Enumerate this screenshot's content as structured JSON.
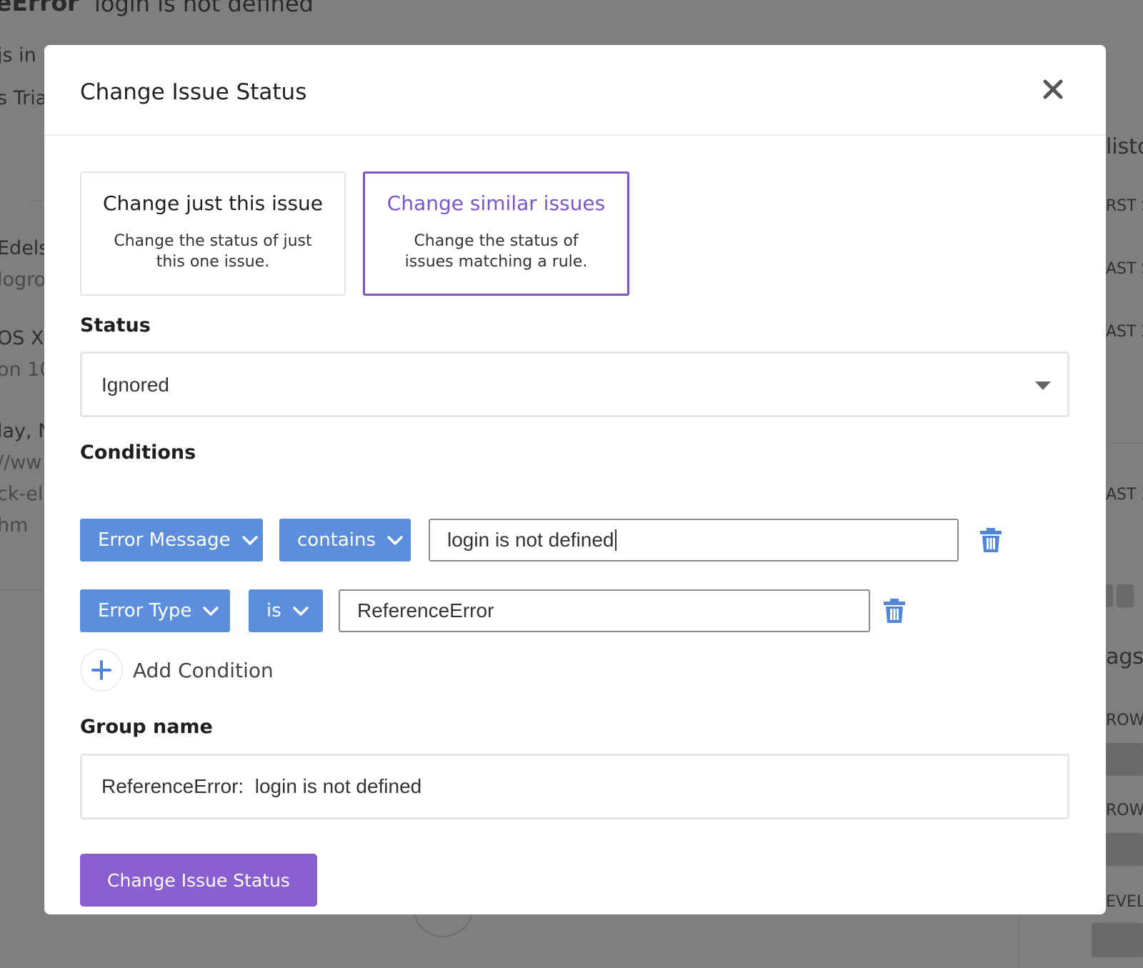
{
  "background": {
    "title": "eError",
    "message": "login is not defined",
    "left_fragments": [
      "js in",
      "s Tria",
      "Edelst",
      "logro",
      "OS X",
      "on 10",
      "lay, N",
      "//ww",
      "ck-el",
      "hm"
    ],
    "right_fragments": [
      "listo",
      "RST S",
      "AST S",
      "AST 2",
      "AST 3",
      "ags",
      "ROW",
      "ROW",
      "EVEL"
    ]
  },
  "modal": {
    "title": "Change Issue Status",
    "close_icon": "close-icon",
    "options": [
      {
        "title": "Change just this issue",
        "description": "Change the status of just this one issue.",
        "selected": false
      },
      {
        "title": "Change similar issues",
        "description": "Change the status of issues matching a rule.",
        "selected": true
      }
    ],
    "status": {
      "label": "Status",
      "value": "Ignored"
    },
    "conditions": {
      "label": "Conditions",
      "rows": [
        {
          "field": "Error Message",
          "operator": "contains",
          "value": "login is not defined"
        },
        {
          "field": "Error Type",
          "operator": "is",
          "value": "ReferenceError"
        }
      ],
      "add_label": "Add Condition"
    },
    "group_name": {
      "label": "Group name",
      "value": "ReferenceError:  login is not defined"
    },
    "submit_label": "Change Issue Status"
  },
  "colors": {
    "accent_purple": "#7d55c7",
    "button_purple": "#8a5fcf",
    "chip_blue": "#5b8fdd",
    "overlay_gray": "#7f7f7f"
  }
}
